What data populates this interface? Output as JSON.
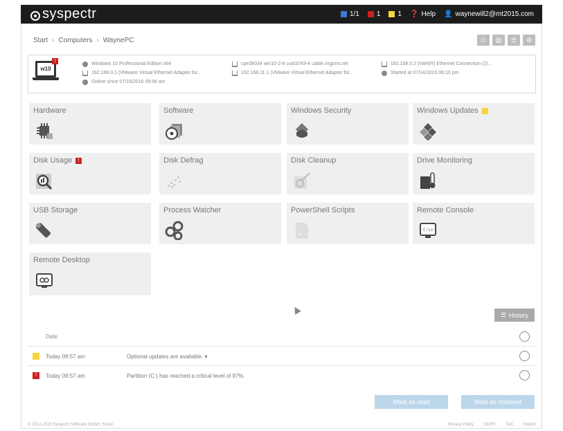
{
  "app": {
    "brand": "syspectr"
  },
  "topbar": {
    "computers_count": "1/1",
    "alerts_red": "1",
    "alerts_yellow": "1",
    "help_label": "Help",
    "user_email": "waynewill2@mt2015.com",
    "colors": {
      "blue": "#3a7bd5",
      "red": "#cc2222",
      "yellow": "#f5d640"
    }
  },
  "breadcrumb": [
    "Start",
    "Computers",
    "WaynePC"
  ],
  "header_buttons": [
    "power-icon",
    "doc-icon",
    "list-icon",
    "settings-icon"
  ],
  "computer": {
    "os_badge_text": "w10",
    "alert_badge": "!",
    "info_col1": [
      {
        "icon": "windows-icon",
        "text": "Windows 10 Professional Edition x64"
      },
      {
        "icon": "network-icon",
        "text": "192.168.0.1 (VMware Virtual Ethernet Adapter for..."
      },
      {
        "icon": "clock-icon",
        "text": "Online since 07/15/2016 09:56 am"
      }
    ],
    "info_col2": [
      {
        "icon": "network-icon",
        "text": "cpe38034 win10-2-8 cust3743-4 cable.virginm.net"
      },
      {
        "icon": "network-icon",
        "text": "192.168.11.1 (VMware Virtual Ethernet Adapter for..."
      }
    ],
    "info_col3": [
      {
        "icon": "network-icon",
        "text": "192.168.0.2 (Intel(R) Ethernet Connection (2)..."
      },
      {
        "icon": "clock-icon",
        "text": "Started at 07/14/2016 06:10 pm"
      }
    ]
  },
  "tiles": [
    {
      "label": "Hardware",
      "icon": "chip-icon",
      "badge": ""
    },
    {
      "label": "Software",
      "icon": "disc-icon",
      "badge": ""
    },
    {
      "label": "Windows Security",
      "icon": "shield-icon",
      "badge": ""
    },
    {
      "label": "Windows Updates",
      "icon": "windows-update-icon",
      "badge": "yellow"
    },
    {
      "label": "Disk Usage",
      "icon": "disk-usage-icon",
      "badge": "red"
    },
    {
      "label": "Disk Defrag",
      "icon": "defrag-icon",
      "badge": ""
    },
    {
      "label": "Disk Cleanup",
      "icon": "cleanup-icon",
      "badge": ""
    },
    {
      "label": "Drive Monitoring",
      "icon": "thermometer-icon",
      "badge": ""
    },
    {
      "label": "USB Storage",
      "icon": "usb-icon",
      "badge": ""
    },
    {
      "label": "Process Watcher",
      "icon": "gears-icon",
      "badge": ""
    },
    {
      "label": "PowerShell Scripts",
      "icon": "script-icon",
      "badge": ""
    },
    {
      "label": "Remote Console",
      "icon": "console-icon",
      "badge": ""
    },
    {
      "label": "Remote Desktop",
      "icon": "remote-desktop-icon",
      "badge": ""
    }
  ],
  "history_button": "History",
  "table": {
    "col_date": "Date",
    "rows": [
      {
        "severity": "yellow",
        "time": "Today 09:57 am",
        "message": "Optional updates are available. ▾"
      },
      {
        "severity": "red",
        "time": "Today 09:57 am",
        "message": "Partition (C:) has reached a critical level of 97%."
      }
    ]
  },
  "actions": {
    "mark_read": "Mark as read",
    "mark_resolved": "Mark as resolved"
  },
  "footer": {
    "copyright": "© 2012-2016 Syspectr Software GmbH. Sonar",
    "links": [
      "Privacy Policy",
      "GDPR",
      "T&C",
      "Imprint"
    ]
  }
}
